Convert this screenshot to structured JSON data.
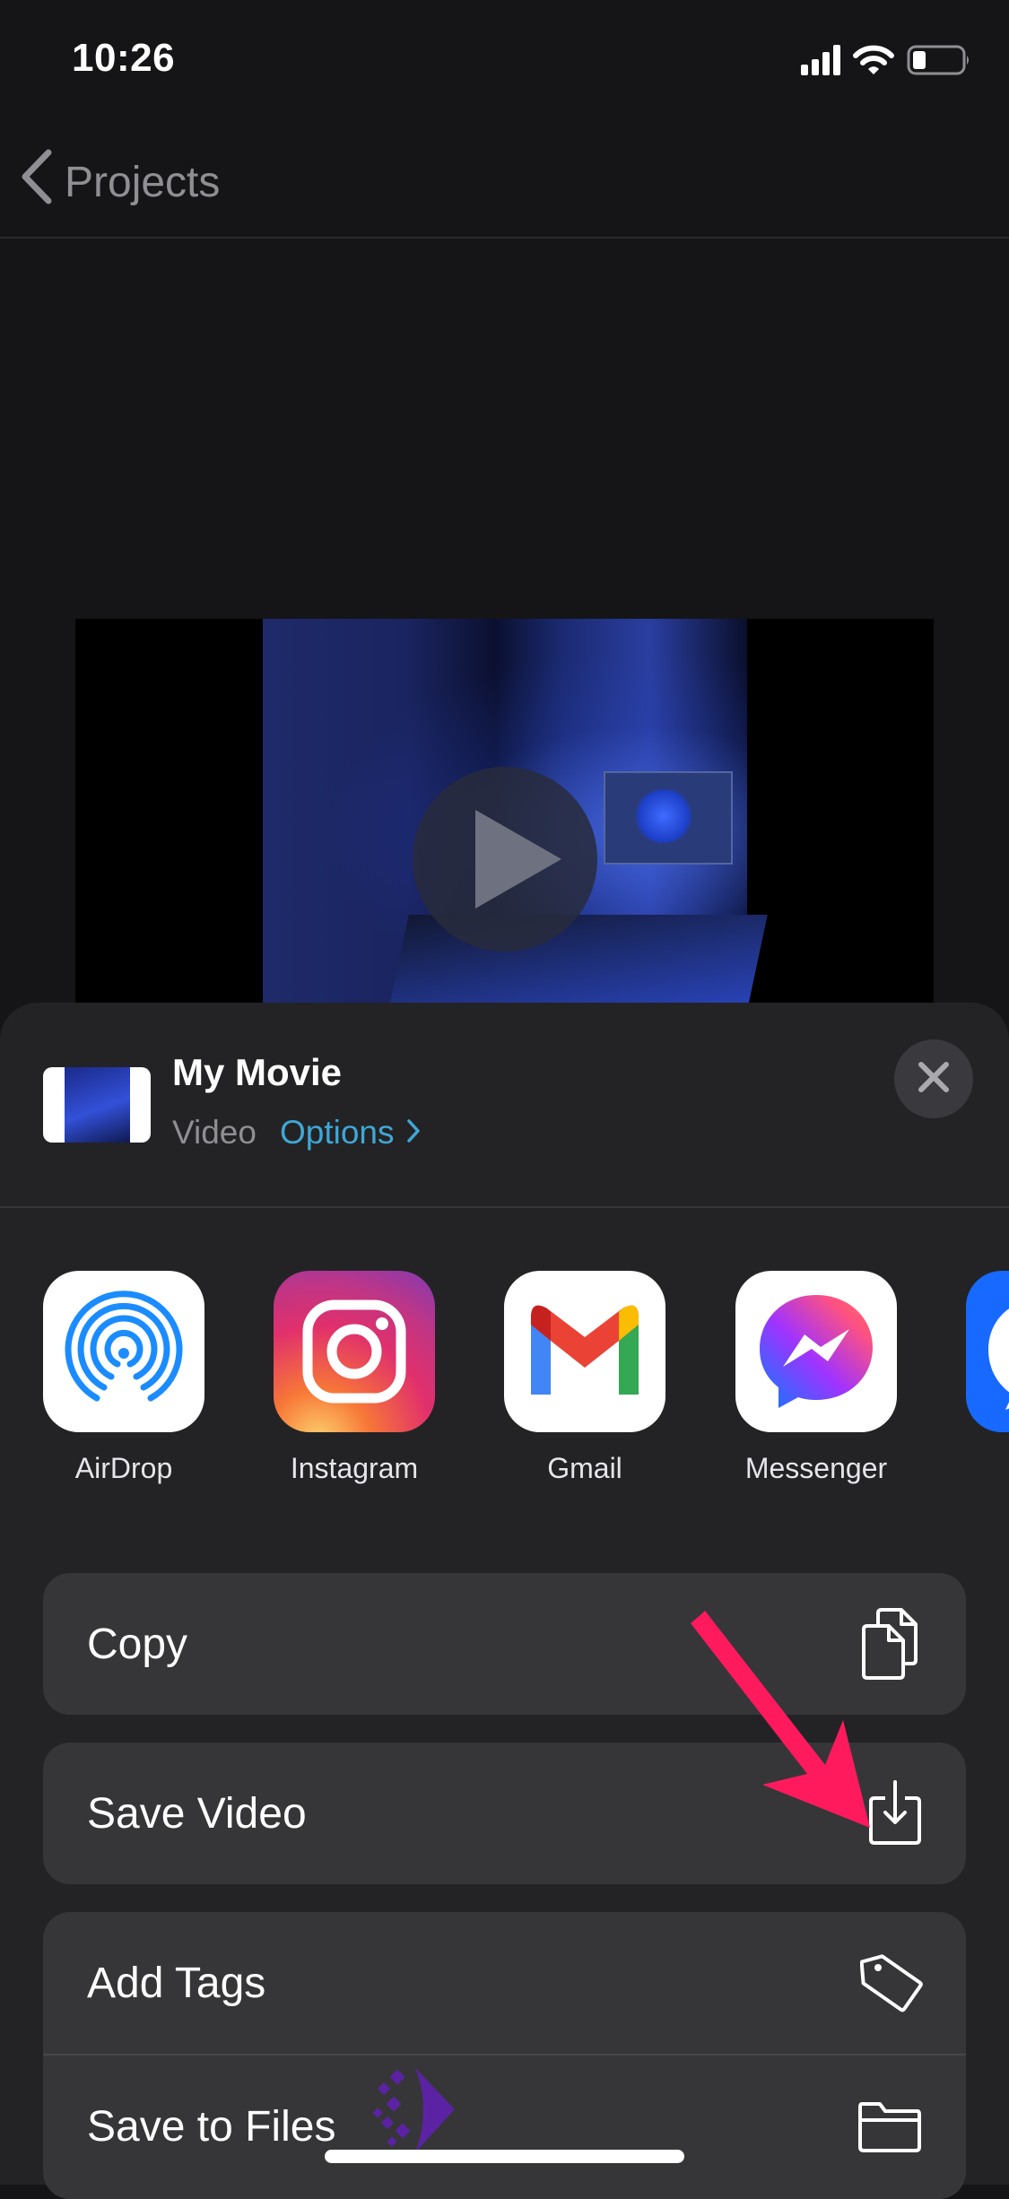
{
  "status_bar": {
    "time": "10:26",
    "signal_icon": "cellular-signal-icon",
    "wifi_icon": "wifi-icon",
    "battery_icon": "battery-icon",
    "battery_level_percent": 25
  },
  "nav": {
    "back_icon": "chevron-left-icon",
    "back_label": "Projects"
  },
  "video_preview": {
    "play_icon": "play-icon"
  },
  "share_sheet": {
    "title": "My Movie",
    "type_label": "Video",
    "options_label": "Options",
    "options_icon": "chevron-right-icon",
    "close_icon": "close-icon",
    "accent_color": "#3fa7d6",
    "apps": [
      {
        "label": "AirDrop",
        "icon": "airdrop-icon"
      },
      {
        "label": "Instagram",
        "icon": "instagram-icon"
      },
      {
        "label": "Gmail",
        "icon": "gmail-icon"
      },
      {
        "label": "Messenger",
        "icon": "messenger-icon"
      },
      {
        "label": "",
        "icon": "chat-app-icon"
      }
    ],
    "actions": [
      {
        "label": "Copy",
        "icon": "copy-icon"
      },
      {
        "label": "Save Video",
        "icon": "save-download-icon"
      },
      {
        "label": "Add Tags",
        "icon": "tag-icon"
      },
      {
        "label": "Save to Files",
        "icon": "folder-icon"
      }
    ]
  },
  "annotation": {
    "arrow_icon": "pointer-arrow-icon",
    "arrow_color": "#ff1a5e"
  }
}
